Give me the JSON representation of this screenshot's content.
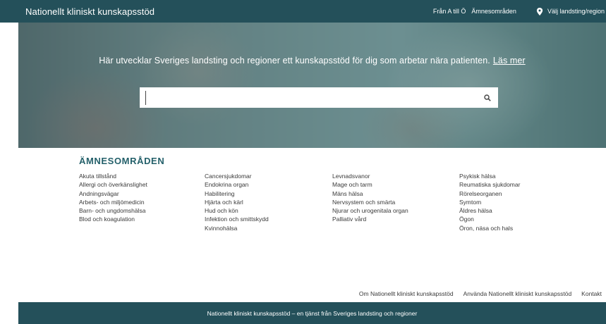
{
  "header": {
    "brand": "Nationellt kliniskt kunskapsstöd",
    "nav": [
      "Från A till Ö",
      "Ämnesområden"
    ],
    "region_label": "Välj landsting/region"
  },
  "hero": {
    "tagline": "Här utvecklar Sveriges landsting och regioner ett kunskapsstöd för dig som arbetar nära patienten.",
    "read_more": "Läs mer",
    "search_value": "",
    "search_placeholder": ""
  },
  "subjects": {
    "title": "ÄMNESOMRÅDEN",
    "col1": [
      "Akuta tillstånd",
      "Allergi och överkänslighet",
      "Andningsvägar",
      "Arbets- och miljömedicin",
      "Barn- och ungdomshälsa",
      "Blod och koagulation"
    ],
    "col2": [
      "Cancersjukdomar",
      "Endokrina organ",
      "Habilitering",
      "Hjärta och kärl",
      "Hud och kön",
      "Infektion och smittskydd",
      "Kvinnohälsa"
    ],
    "col3": [
      "Levnadsvanor",
      "Mage och tarm",
      "Mäns hälsa",
      "Nervsystem och smärta",
      "Njurar och urogenitala organ",
      "Palliativ vård"
    ],
    "col4": [
      "Psykisk hälsa",
      "Reumatiska sjukdomar",
      "Rörelseorganen",
      "Symtom",
      "Äldres hälsa",
      "Ögon",
      "Öron, näsa och hals"
    ]
  },
  "footer": {
    "links": [
      "Om Nationellt kliniskt kunskapsstöd",
      "Använda Nationellt kliniskt kunskapsstöd",
      "Kontakt"
    ],
    "bottom_text": "Nationellt kliniskt kunskapsstöd – en tjänst från Sveriges landsting och regioner"
  },
  "icons": {
    "search": "search-icon",
    "region": "map-pin-icon"
  },
  "colors": {
    "brand": "#24505a",
    "heading": "#24606a",
    "hero_overlay": "#347076"
  }
}
